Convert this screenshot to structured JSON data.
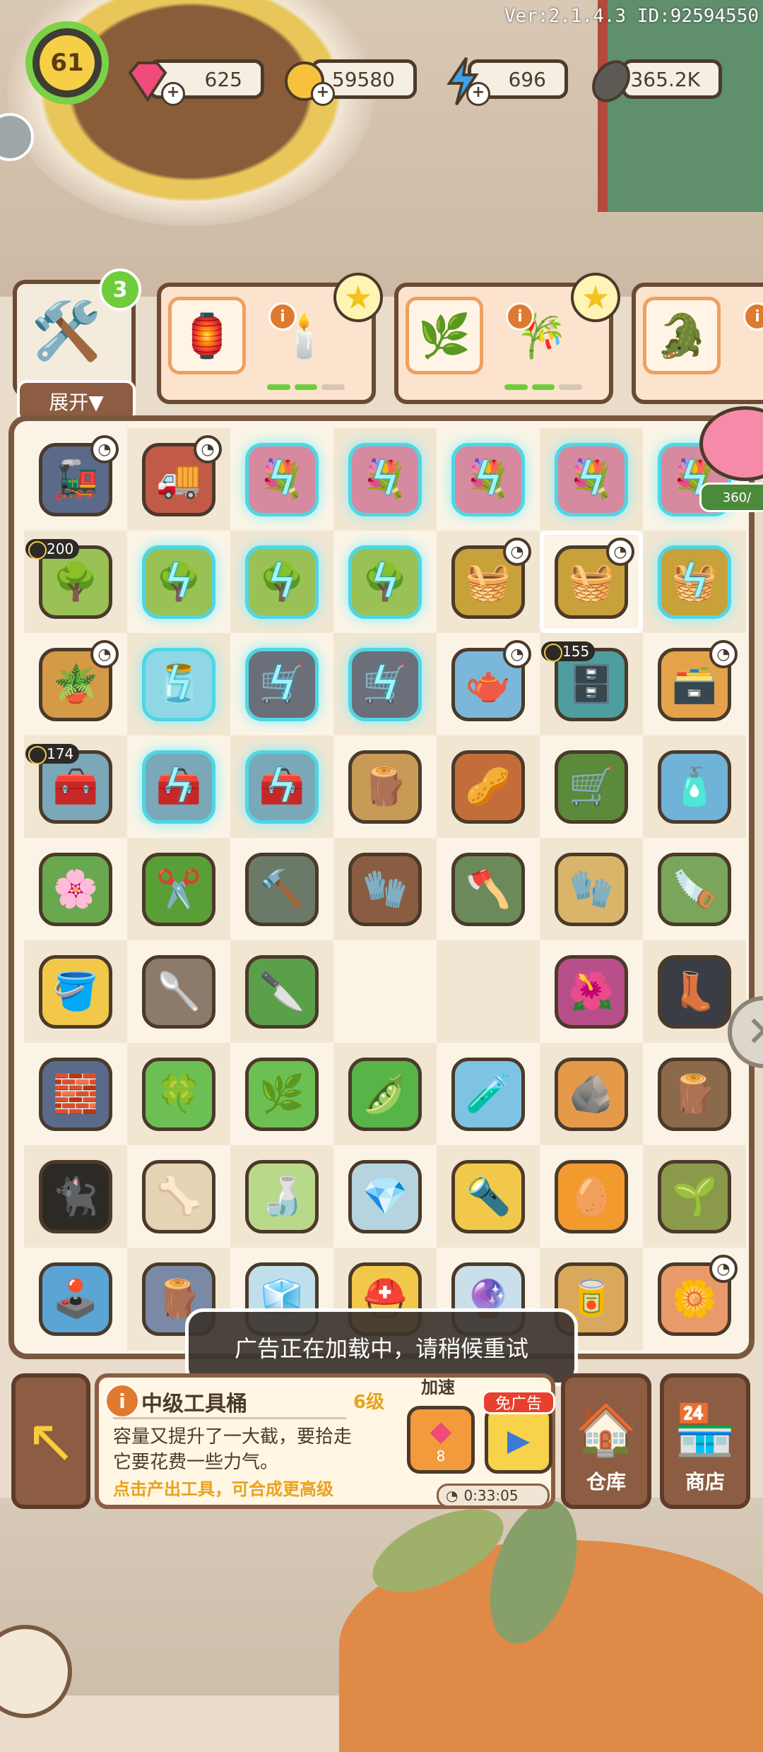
{
  "header": {
    "version": "Ver:2.1.4.3 ID:92594550",
    "level": "61",
    "resources": [
      {
        "name": "gems",
        "icon": "gem-icon",
        "value": "625",
        "color": "#f04b7a"
      },
      {
        "name": "coins",
        "icon": "coin-icon",
        "value": "59580",
        "color": "#f6c23c"
      },
      {
        "name": "energy",
        "icon": "lightning-icon",
        "value": "696",
        "color": "#3aa4e8"
      },
      {
        "name": "seeds",
        "icon": "sunflower-seed-icon",
        "value": "365.2K",
        "color": "#4b3a2a"
      }
    ]
  },
  "orders": {
    "expand_label": "展开▼",
    "expand_count": "3",
    "cards": [
      {
        "slots": [
          "lantern-item",
          "candle-jar-item"
        ],
        "star": true,
        "progress": [
          1,
          1,
          0
        ]
      },
      {
        "slots": [
          "mossy-arch-item",
          "potted-bamboo-item"
        ],
        "star": true,
        "progress": [
          1,
          1,
          0
        ]
      },
      {
        "slots": [
          "crocodile-planter-item"
        ],
        "star": false,
        "progress": []
      }
    ]
  },
  "board": {
    "pig_progress": "360/",
    "rows": [
      [
        {
          "icon": "steam-train-icon",
          "emoji": "🚂",
          "bg": "#5c6a89",
          "clock": true
        },
        {
          "icon": "cart-icon",
          "emoji": "🚚",
          "bg": "#c25a48",
          "clock": true
        },
        {
          "icon": "flower-pot-icon",
          "emoji": "💐",
          "bg": "#d68aa0",
          "locked": true
        },
        {
          "icon": "flower-pot-icon",
          "emoji": "💐",
          "bg": "#d68aa0",
          "locked": true
        },
        {
          "icon": "flower-pot-icon",
          "emoji": "💐",
          "bg": "#d68aa0",
          "locked": true
        },
        {
          "icon": "flower-pot-icon",
          "emoji": "💐",
          "bg": "#d68aa0",
          "locked": true
        },
        {
          "icon": "flower-pot-icon",
          "emoji": "💐",
          "bg": "#d68aa0",
          "locked": true
        }
      ],
      [
        {
          "icon": "fruit-tree-icon",
          "emoji": "🌳",
          "bg": "#9ac155",
          "cat": "200",
          "glow": true
        },
        {
          "icon": "fruit-tree-icon",
          "emoji": "🌳",
          "bg": "#9ac155",
          "locked": true
        },
        {
          "icon": "fruit-tree-icon",
          "emoji": "🌳",
          "bg": "#9ac155",
          "locked": true
        },
        {
          "icon": "fruit-tree-icon",
          "emoji": "🌳",
          "bg": "#9ac155",
          "locked": true
        },
        {
          "icon": "tool-bucket-icon",
          "emoji": "🧺",
          "bg": "#c9a13a",
          "clock": true
        },
        {
          "icon": "tool-bucket-icon",
          "emoji": "🧺",
          "bg": "#c9a13a",
          "clock": true,
          "selected": true
        },
        {
          "icon": "tool-bucket-icon",
          "emoji": "🧺",
          "bg": "#c9a13a",
          "locked": true
        }
      ],
      [
        {
          "icon": "soil-pot-icon",
          "emoji": "🪴",
          "bg": "#d49a46",
          "clock": true
        },
        {
          "icon": "water-basin-icon",
          "emoji": "🫙",
          "bg": "#8fd7e6",
          "locked": true
        },
        {
          "icon": "mine-cart-icon",
          "emoji": "🛒",
          "bg": "#6a6f7a",
          "locked": true
        },
        {
          "icon": "mine-cart-icon",
          "emoji": "🛒",
          "bg": "#6a6f7a",
          "locked": true
        },
        {
          "icon": "teapot-flower-icon",
          "emoji": "🫖",
          "bg": "#7bb7d8",
          "clock": true
        },
        {
          "icon": "cabinet-icon",
          "emoji": "🗄️",
          "bg": "#4e9e9f",
          "cat": "155",
          "glow": true
        },
        {
          "icon": "shelf-icon",
          "emoji": "🗃️",
          "bg": "#e4a24a",
          "clock": true
        }
      ],
      [
        {
          "icon": "toolbox-icon",
          "emoji": "🧰",
          "bg": "#7aa8b8",
          "cat": "174",
          "glow": true
        },
        {
          "icon": "toolbox-icon",
          "emoji": "🧰",
          "bg": "#7aa8b8",
          "locked": true
        },
        {
          "icon": "toolbox-icon",
          "emoji": "🧰",
          "bg": "#7aa8b8",
          "locked": true
        },
        {
          "icon": "sandbags-icon",
          "emoji": "🪵",
          "bg": "#c79a56"
        },
        {
          "icon": "seeds-icon",
          "emoji": "🥜",
          "bg": "#c36d3a"
        },
        {
          "icon": "hand-truck-icon",
          "emoji": "🛒",
          "bg": "#5a8a3a"
        },
        {
          "icon": "spray-bottle-icon",
          "emoji": "🧴",
          "bg": "#6fb3d9"
        }
      ],
      [
        {
          "icon": "rainbow-plant-icon",
          "emoji": "🌸",
          "bg": "#6aa84f"
        },
        {
          "icon": "pruning-shears-icon",
          "emoji": "✂️",
          "bg": "#5a9e36"
        },
        {
          "icon": "hammer-icon",
          "emoji": "🔨",
          "bg": "#6b7a68"
        },
        {
          "icon": "paw-glove-icon",
          "emoji": "🧤",
          "bg": "#8a5d42"
        },
        {
          "icon": "axe-icon",
          "emoji": "🪓",
          "bg": "#6b8a5a"
        },
        {
          "icon": "gardening-gloves-icon",
          "emoji": "🧤",
          "bg": "#d9b56a"
        },
        {
          "icon": "saw-icon",
          "emoji": "🪚",
          "bg": "#7aa55a"
        }
      ],
      [
        {
          "icon": "water-bucket-icon",
          "emoji": "🪣",
          "bg": "#f2c84b"
        },
        {
          "icon": "trowel-icon",
          "emoji": "🥄",
          "bg": "#8c7a6a"
        },
        {
          "icon": "knife-icon",
          "emoji": "🔪",
          "bg": "#5aa04a"
        },
        {
          "icon": "empty",
          "emoji": "",
          "bg": "",
          "empty": true
        },
        {
          "icon": "empty",
          "emoji": "",
          "bg": "",
          "empty": true
        },
        {
          "icon": "flower-icon",
          "emoji": "🌺",
          "bg": "#b94f8a"
        },
        {
          "icon": "rain-boots-icon",
          "emoji": "👢",
          "bg": "#3a3d44"
        }
      ],
      [
        {
          "icon": "stone-slabs-icon",
          "emoji": "🧱",
          "bg": "#5a6a8a"
        },
        {
          "icon": "clover-icon",
          "emoji": "🍀",
          "bg": "#6cbf53"
        },
        {
          "icon": "succulent-icon",
          "emoji": "🌿",
          "bg": "#6cbf53"
        },
        {
          "icon": "pea-pods-icon",
          "emoji": "🫛",
          "bg": "#57b547"
        },
        {
          "icon": "dropper-bottle-icon",
          "emoji": "🧪",
          "bg": "#7ec3e3"
        },
        {
          "icon": "ore-rock-icon",
          "emoji": "🪨",
          "bg": "#e59a4a"
        },
        {
          "icon": "root-icon",
          "emoji": "🪵",
          "bg": "#8a6a4a"
        }
      ],
      [
        {
          "icon": "black-cat-icon",
          "emoji": "🐈‍⬛",
          "bg": "#2d2a26"
        },
        {
          "icon": "pipes-icon",
          "emoji": "🦴",
          "bg": "#e6d2b4"
        },
        {
          "icon": "glass-bottle-icon",
          "emoji": "🍶",
          "bg": "#b9d98a"
        },
        {
          "icon": "crystal-pile-icon",
          "emoji": "💎",
          "bg": "#b6d4df"
        },
        {
          "icon": "flashlight-icon",
          "emoji": "🔦",
          "bg": "#f2c84b"
        },
        {
          "icon": "amber-egg-icon",
          "emoji": "🥚",
          "bg": "#f29a2e"
        },
        {
          "icon": "seedling-box-icon",
          "emoji": "🌱",
          "bg": "#8a9a4a"
        }
      ],
      [
        {
          "icon": "arcade-machine-icon",
          "emoji": "🕹️",
          "bg": "#5aa4d6"
        },
        {
          "icon": "logs-icon",
          "emoji": "🪵",
          "bg": "#7a8aa6"
        },
        {
          "icon": "ice-chunks-icon",
          "emoji": "🧊",
          "bg": "#bfe0ea"
        },
        {
          "icon": "helmet-icon",
          "emoji": "⛑️",
          "bg": "#f2c84b"
        },
        {
          "icon": "crystal-ball-icon",
          "emoji": "🔮",
          "bg": "#c9dfe9"
        },
        {
          "icon": "paint-can-icon",
          "emoji": "🥫",
          "bg": "#d9a85a"
        },
        {
          "icon": "rainbow-flower-pot-icon",
          "emoji": "🌼",
          "bg": "#e89a6a",
          "clock": true
        }
      ]
    ]
  },
  "toast": "广告正在加载中，请稍候重试",
  "panel": {
    "item_name": "中级工具桶",
    "item_level": "6级",
    "description": "容量又提升了一大截，要拾走它要花费一些力气。",
    "hint": "点击产出工具，可合成更高级",
    "speed_label": "加速",
    "gem_cost": "8",
    "ad_label": "免广告",
    "timer": "0:33:05"
  },
  "buttons": {
    "warehouse": "仓库",
    "shop": "商店"
  }
}
